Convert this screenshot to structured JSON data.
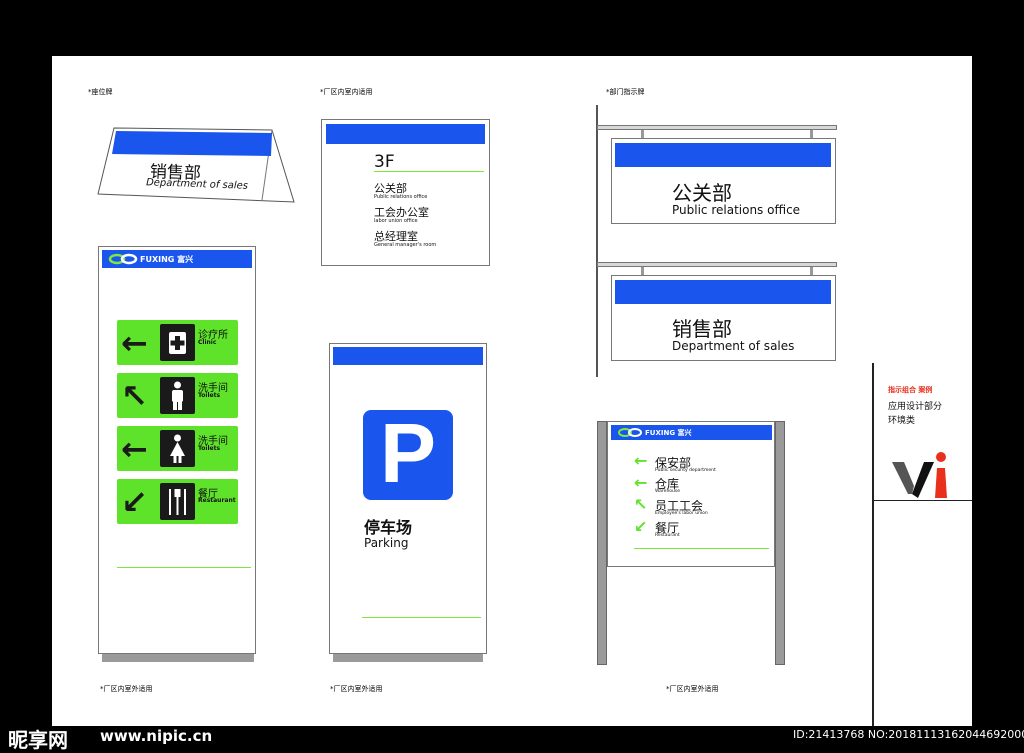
{
  "section_labels": {
    "desk_sign": "*座位牌",
    "indoor_plant": "*厂区内室内适用",
    "dept_sign": "*部门指示牌",
    "outdoor_1": "*厂区内室外适用",
    "outdoor_2": "*厂区内室外适用",
    "outdoor_3": "*厂区内室外适用"
  },
  "desk_sign": {
    "zh": "销售部",
    "en": "Department of sales"
  },
  "floor_sign": {
    "floor": "3F",
    "rows": [
      {
        "zh": "公关部",
        "en": "Public relations office"
      },
      {
        "zh": "工会办公室",
        "en": "labor union office"
      },
      {
        "zh": "总经理室",
        "en": "General manager's room"
      }
    ]
  },
  "hanging_signs": [
    {
      "zh": "公关部",
      "en": "Public relations office"
    },
    {
      "zh": "销售部",
      "en": "Department of sales"
    }
  ],
  "brand": {
    "en": "FUXING",
    "zh": "富兴"
  },
  "directory_totem": {
    "items": [
      {
        "arrow": "←",
        "icon": "clinic-icon",
        "zh": "诊疗所",
        "en": "Clinic"
      },
      {
        "arrow": "↖",
        "icon": "man-icon",
        "zh": "洗手间",
        "en": "Toilets"
      },
      {
        "arrow": "←",
        "icon": "woman-icon",
        "zh": "洗手间",
        "en": "Toilets"
      },
      {
        "arrow": "↙",
        "icon": "cutlery-icon",
        "zh": "餐厅",
        "en": "Restaurant"
      }
    ]
  },
  "parking_sign": {
    "letter": "P",
    "zh": "停车场",
    "en": "Parking"
  },
  "outdoor_board": {
    "items": [
      {
        "arrow": "←",
        "zh": "保安部",
        "en": "Public security department"
      },
      {
        "arrow": "←",
        "zh": "仓库",
        "en": "Warehouse"
      },
      {
        "arrow": "↖",
        "zh": "员工工会",
        "en": "Employee's labor union"
      },
      {
        "arrow": "↙",
        "zh": "餐厅",
        "en": "Restaurant"
      }
    ]
  },
  "side_card": {
    "line1": "指示组合 案例",
    "line2": "应用设计部分",
    "line3": "环境类",
    "logo_letters": "vi"
  },
  "watermark": {
    "brand": "昵享网",
    "url": "www.nipic.cn",
    "id": "ID:21413768 NO:20181113162044692000"
  },
  "colors": {
    "blue": "#1a56ee",
    "green": "#5fe32a",
    "line_green": "#7ee83a",
    "accent_red": "#e8301c"
  }
}
